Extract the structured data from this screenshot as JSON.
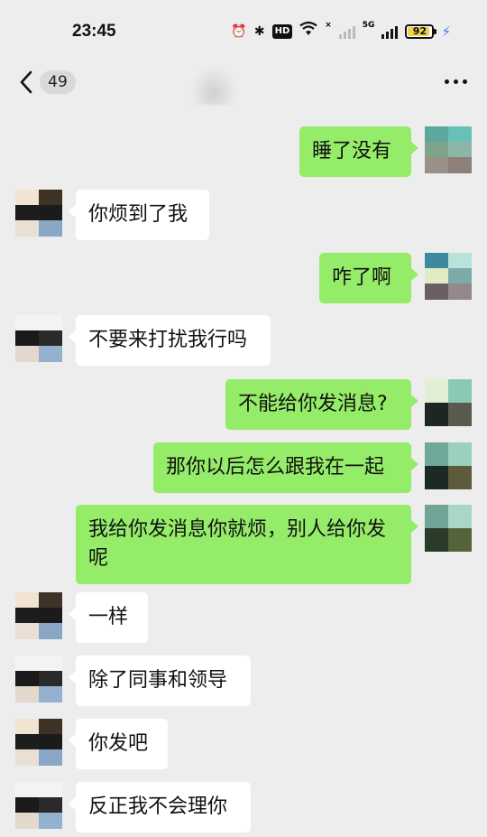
{
  "status_bar": {
    "time": "23:45",
    "icons": [
      "alarm-icon",
      "bluetooth-icon",
      "hd-icon",
      "wifi-icon",
      "signal-4g-icon",
      "signal-5g-icon"
    ],
    "hd_label": "HD",
    "net_label_1": "×",
    "net_label_2": "5G",
    "battery_percent": "92",
    "battery_level": 0.92,
    "charging": true
  },
  "nav": {
    "back_icon": "chevron-left-icon",
    "unread_count": "49",
    "more_icon": "more-dots-icon"
  },
  "colors": {
    "background": "#ededed",
    "incoming_bubble": "#ffffff",
    "outgoing_bubble": "#95ec69",
    "battery_fill": "#f0d34a",
    "charging_bolt": "#3b7cf7"
  },
  "messages": [
    {
      "direction": "out",
      "text": "睡了没有"
    },
    {
      "direction": "in",
      "text": "你烦到了我"
    },
    {
      "direction": "out",
      "text": "咋了啊"
    },
    {
      "direction": "in",
      "text": "不要来打扰我行吗"
    },
    {
      "direction": "out",
      "text": "不能给你发消息?"
    },
    {
      "direction": "out",
      "text": "那你以后怎么跟我在一起"
    },
    {
      "direction": "out",
      "text": "我给你发消息你就烦，别人给你发呢"
    },
    {
      "direction": "in",
      "text": "一样"
    },
    {
      "direction": "in",
      "text": "除了同事和领导"
    },
    {
      "direction": "in",
      "text": "你发吧"
    },
    {
      "direction": "in",
      "text": "反正我不会理你"
    }
  ]
}
